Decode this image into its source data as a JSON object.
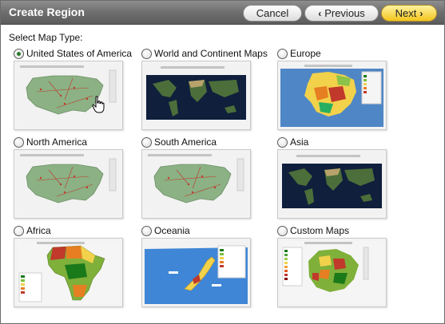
{
  "header": {
    "title": "Create Region",
    "cancel_label": "Cancel",
    "previous_label": "Previous",
    "next_label": "Next"
  },
  "main": {
    "section_label": "Select Map Type:",
    "selected": "United States of America",
    "options": [
      {
        "label": "United States of America",
        "thumbnail": "usa-map",
        "checked": true
      },
      {
        "label": "World and Continent Maps",
        "thumbnail": "world-map",
        "checked": false
      },
      {
        "label": "Europe",
        "thumbnail": "europe-map",
        "checked": false
      },
      {
        "label": "North America",
        "thumbnail": "usa-map",
        "checked": false
      },
      {
        "label": "South America",
        "thumbnail": "usa-map",
        "checked": false
      },
      {
        "label": "Asia",
        "thumbnail": "world-map",
        "checked": false
      },
      {
        "label": "Africa",
        "thumbnail": "africa-map",
        "checked": false
      },
      {
        "label": "Oceania",
        "thumbnail": "oceania-map",
        "checked": false
      },
      {
        "label": "Custom Maps",
        "thumbnail": "custom-map",
        "checked": false
      }
    ]
  },
  "colors": {
    "titlebar": "#6e6e6e",
    "next_button": "#f2c51c",
    "selected_radio": "#2a7a2a"
  }
}
